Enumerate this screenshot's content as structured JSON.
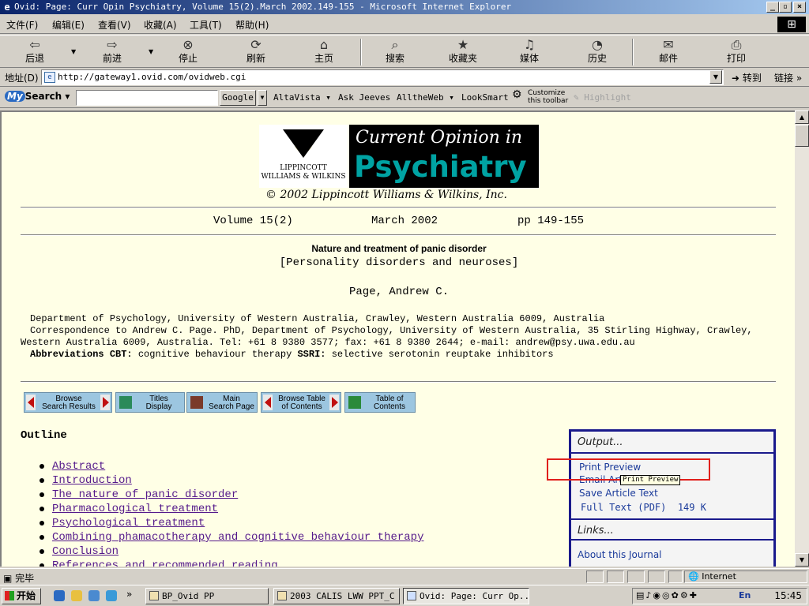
{
  "window": {
    "title": "Ovid: Page: Curr Opin Psychiatry, Volume 15(2).March 2002.149-155 - Microsoft Internet Explorer",
    "controls": [
      "_",
      "▫",
      "×"
    ]
  },
  "menu": [
    "文件(F)",
    "编辑(E)",
    "查看(V)",
    "收藏(A)",
    "工具(T)",
    "帮助(H)"
  ],
  "toolbar": {
    "back": "后退",
    "forward": "前进",
    "stop": "停止",
    "refresh": "刷新",
    "home": "主页",
    "search": "搜索",
    "favorites": "收藏夹",
    "media": "媒体",
    "history": "历史",
    "mail": "邮件",
    "print": "打印"
  },
  "address": {
    "label": "地址(D)",
    "url": "http://gateway1.ovid.com/ovidweb.cgi",
    "go": "转到",
    "links": "链接"
  },
  "search_toolbar": {
    "brand_my": "My",
    "brand_search": "Search",
    "input_value": "",
    "engines": [
      "Google",
      "AltaVista",
      "Ask Jeeves",
      "AlltheWeb",
      "LookSmart"
    ],
    "customize": [
      "Customize",
      "this toolbar"
    ],
    "highlight": "Highlight"
  },
  "page": {
    "logo_publisher": [
      "LIPPINCOTT",
      "WILLIAMS & WILKINS"
    ],
    "logo_journal_line1": "Current Opinion in",
    "logo_journal_line2": "Psychiatry",
    "copyright": "© 2002 Lippincott Williams & Wilkins, Inc.",
    "volume": "Volume 15(2)",
    "date": "March 2002",
    "pages": "pp 149-155",
    "article_title": "Nature and treatment of panic disorder",
    "article_section": "[Personality disorders and neuroses]",
    "author": "Page, Andrew C.",
    "affiliation": "Department of Psychology, University of Western Australia, Crawley, Western Australia 6009, Australia",
    "correspondence_1": "Correspondence to Andrew C. Page. PhD, Department of Psychology, University of Western Australia, 35 Stirling Highway, Crawley,",
    "correspondence_2": "Western Australia 6009, Australia. Tel: +61 8 9380 3577; fax: +61 8 9380 2644; e-mail: andrew@psy.uwa.edu.au",
    "abbrev_label": "Abbreviations",
    "abbrev_cbt_label": "CBT:",
    "abbrev_cbt": "cognitive behaviour therapy",
    "abbrev_ssri_label": "SSRI:",
    "abbrev_ssri": "selective serotonin reuptake inhibitors",
    "nav_buttons": {
      "browse_results": [
        "Browse",
        "Search Results"
      ],
      "titles_display": [
        "Titles",
        "Display"
      ],
      "main_search": [
        "Main",
        "Search Page"
      ],
      "browse_toc": [
        "Browse Table",
        "of Contents"
      ],
      "toc": [
        "Table of",
        "Contents"
      ]
    },
    "outline_heading": "Outline",
    "outline_items": [
      "Abstract",
      "Introduction",
      "The nature of panic disorder",
      "Pharmacological treatment",
      "Psychological treatment",
      "Combining phamacotherapy and cognitive behaviour therapy",
      "Conclusion",
      "References and recommended reading"
    ],
    "output_panel": {
      "heading": "Output...",
      "print_preview": "Print Preview",
      "email": "Email Article Text",
      "save": "Save Article Text",
      "fulltext": "Full Text (PDF)  149 K",
      "links_heading": "Links...",
      "about": "About this Journal"
    },
    "tooltip": "Print Preview"
  },
  "status": {
    "text": "完毕",
    "zone": "Internet"
  },
  "taskbar": {
    "start": "开始",
    "tasks": [
      "BP_Ovid PP",
      "2003 CALIS LWW PPT_C",
      "Ovid: Page: Curr Op..."
    ],
    "clock": "15:45",
    "lang": "En"
  },
  "colors": {
    "page_bg": "#ffffe6",
    "link_visited": "#551a8b",
    "panel_border": "#1a1a8c",
    "highlight_box": "#e0201c",
    "journal_teal": "#00a3a3"
  }
}
